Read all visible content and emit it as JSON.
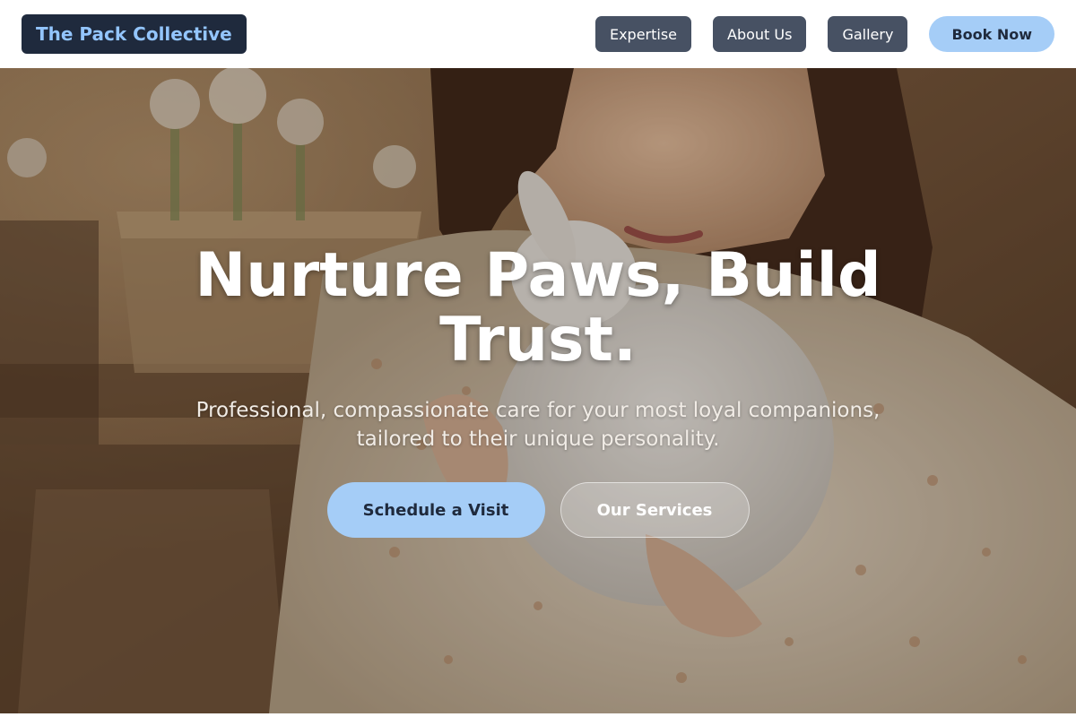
{
  "header": {
    "brand": "The Pack Collective",
    "nav": [
      {
        "label": "Expertise"
      },
      {
        "label": "About Us"
      },
      {
        "label": "Gallery"
      }
    ],
    "cta_label": "Book Now"
  },
  "hero": {
    "title": "Nurture Paws, Build Trust.",
    "subtitle": "Professional, compassionate care for your most loyal companions, tailored to their unique personality.",
    "primary_label": "Schedule a Visit",
    "secondary_label": "Our Services",
    "photo_subject": "woman-holding-white-rabbit"
  },
  "colors": {
    "brand_bg": "#1f2a3d",
    "brand_text": "#93c5fd",
    "nav_button": "#475163",
    "accent": "#a5cdf7"
  }
}
